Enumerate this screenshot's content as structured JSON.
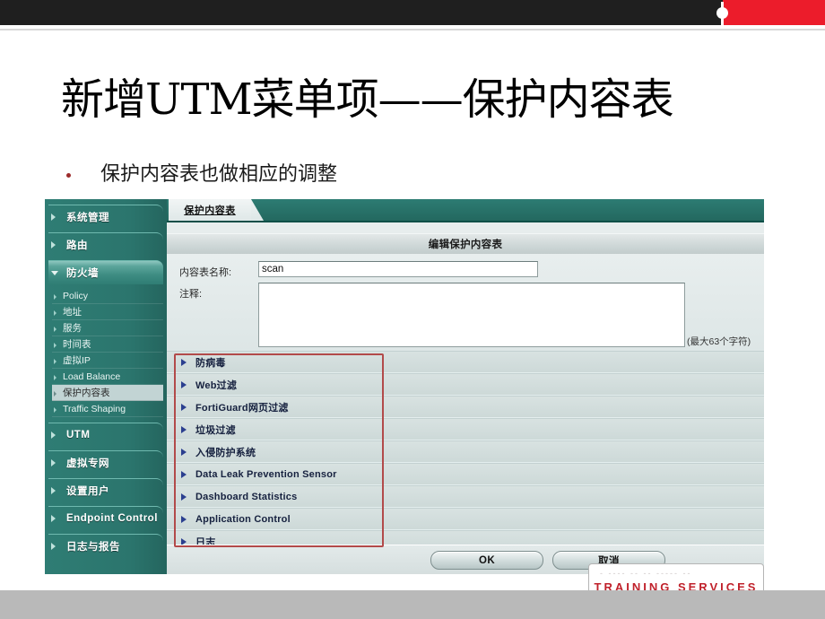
{
  "slide": {
    "title": "新增UTM菜单项——保护内容表",
    "bullet": "保护内容表也做相应的调整"
  },
  "banner": {
    "black_color": "#1f1f1f",
    "red_color": "#ec1c2b"
  },
  "screenshot": {
    "sidebar": {
      "items": [
        {
          "label": "系统管理",
          "type": "group",
          "state": "collapsed"
        },
        {
          "label": "路由",
          "type": "group",
          "state": "collapsed"
        },
        {
          "label": "防火墙",
          "type": "group",
          "state": "expanded"
        },
        {
          "label": "UTM",
          "type": "group",
          "state": "collapsed"
        },
        {
          "label": "虚拟专网",
          "type": "group",
          "state": "collapsed"
        },
        {
          "label": "设置用户",
          "type": "group",
          "state": "collapsed"
        },
        {
          "label": "Endpoint Control",
          "type": "group",
          "state": "collapsed"
        },
        {
          "label": "日志与报告",
          "type": "group",
          "state": "collapsed"
        }
      ],
      "firewall_subitems": [
        {
          "label": "Policy",
          "selected": false
        },
        {
          "label": "地址",
          "selected": false
        },
        {
          "label": "服务",
          "selected": false
        },
        {
          "label": "时间表",
          "selected": false
        },
        {
          "label": "虚拟IP",
          "selected": false
        },
        {
          "label": "Load Balance",
          "selected": false
        },
        {
          "label": "保护内容表",
          "selected": true
        },
        {
          "label": "Traffic Shaping",
          "selected": false
        }
      ]
    },
    "tab": {
      "label": "保护内容表"
    },
    "panel_title": "编辑保护内容表",
    "form": {
      "name_label": "内容表名称:",
      "name_value": "scan",
      "comment_label": "注释:",
      "comment_value": "",
      "comment_hint": "(最大63个字符)"
    },
    "accordion": [
      {
        "label": "防病毒"
      },
      {
        "label": "Web过滤"
      },
      {
        "label": "FortiGuard网页过滤"
      },
      {
        "label": "垃圾过滤"
      },
      {
        "label": "入侵防护系统"
      },
      {
        "label": "Data Leak Prevention Sensor"
      },
      {
        "label": "Dashboard Statistics"
      },
      {
        "label": "Application Control"
      },
      {
        "label": "日志"
      }
    ],
    "buttons": {
      "ok": "OK",
      "cancel": "取消"
    }
  },
  "logo": {
    "text": "TRAINING SERVICES",
    "dashes": "-  ----  --  --  -----  --",
    "color": "#c0212b"
  }
}
